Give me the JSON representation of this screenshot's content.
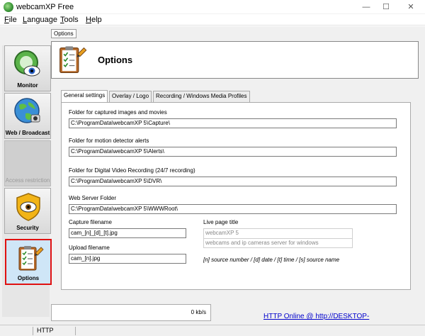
{
  "window": {
    "title": "webcamXP Free",
    "minimize": "—",
    "maximize": "☐",
    "close": "✕"
  },
  "menu": [
    {
      "accel": "F",
      "rest": "ile"
    },
    {
      "accel": "L",
      "rest": "anguage"
    },
    {
      "accel": "T",
      "rest": "ools"
    },
    {
      "accel": "H",
      "rest": "elp"
    }
  ],
  "sidebar": [
    {
      "label": "Monitor",
      "icon": "eye-camera-icon"
    },
    {
      "label": "Web / Broadcast",
      "icon": "globe-icon"
    },
    {
      "label": "Access restriction",
      "icon": "none"
    },
    {
      "label": "Security",
      "icon": "shield-eye-icon"
    },
    {
      "label": "Options",
      "icon": "clipboard-pencil-icon"
    }
  ],
  "options_tab": "Options",
  "header": {
    "title": "Options"
  },
  "tabs": [
    "General settings",
    "Overlay / Logo",
    "Recording / Windows Media Profiles"
  ],
  "general": {
    "capture_folder_label": "Folder for captured images and movies",
    "capture_folder": "C:\\ProgramData\\webcamXP 5\\Capture\\",
    "alerts_folder_label": "Folder for motion detector alerts",
    "alerts_folder": "C:\\ProgramData\\webcamXP 5\\Alerts\\",
    "dvr_folder_label": "Folder for Digital Video Recording (24/7 recording)",
    "dvr_folder": "C:\\ProgramData\\webcamXP 5\\DVR\\",
    "www_folder_label": "Web Server Folder",
    "www_folder": "C:\\ProgramData\\webcamXP 5\\WWWRoot\\",
    "capture_filename_label": "Capture filename",
    "capture_filename": "cam_[n]_[d]_[t].jpg",
    "upload_filename_label": "Upload filename",
    "upload_filename": "cam_[n].jpg",
    "live_title_label": "Live page title",
    "live_title_line1": "webcamXP 5",
    "live_title_line2": "webcams and ip cameras server for windows",
    "hint": "[n] source number / [d] date / [t] time / [s] source name"
  },
  "bandwidth": "0 kb/s",
  "http_link": "HTTP Online @ http://DESKTOP-",
  "statusbar": {
    "http": "HTTP"
  },
  "colors": {
    "selected_border": "#e01010",
    "selected_bg": "#cfe6f7",
    "link": "#0000cc"
  }
}
